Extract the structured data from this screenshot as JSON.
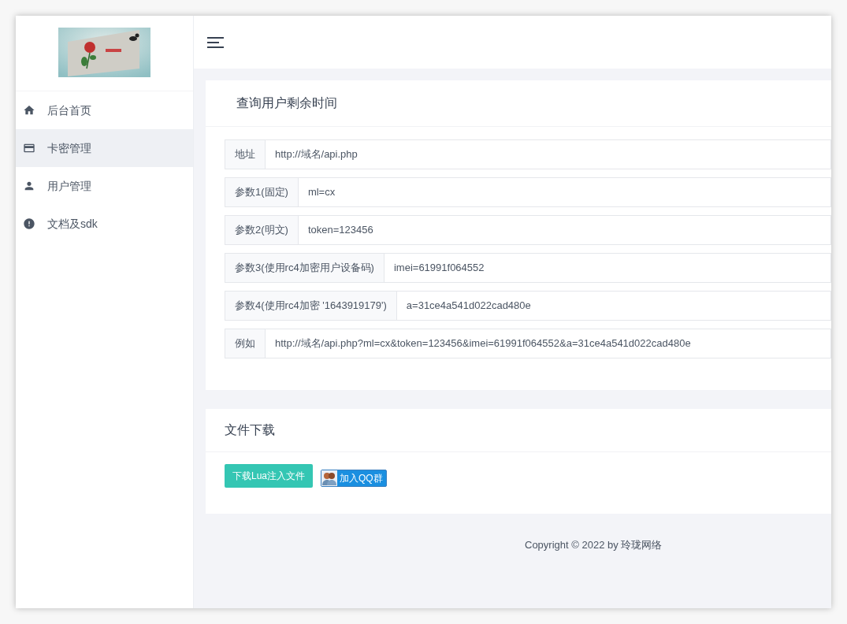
{
  "sidebar": {
    "items": [
      {
        "label": "后台首页",
        "kind": "home",
        "selected": false
      },
      {
        "label": "卡密管理",
        "kind": "card",
        "selected": true
      },
      {
        "label": "用户管理",
        "kind": "user",
        "selected": false
      },
      {
        "label": "文档及sdk",
        "kind": "alert",
        "selected": false
      }
    ]
  },
  "query_card": {
    "title": "查询用户剩余时间",
    "rows": [
      {
        "label": "地址",
        "value": "http://域名/api.php"
      },
      {
        "label": "参数1(固定)",
        "value": "ml=cx"
      },
      {
        "label": "参数2(明文)",
        "value": "token=123456"
      },
      {
        "label": "参数3(使用rc4加密用户设备码)",
        "value": "imei=61991f064552"
      },
      {
        "label": "参数4(使用rc4加密 '1643919179')",
        "value": "a=31ce4a541d022cad480e"
      },
      {
        "label": "例如",
        "value": "http://域名/api.php?ml=cx&token=123456&imei=61991f064552&a=31ce4a541d022cad480e"
      }
    ]
  },
  "download_card": {
    "title": "文件下载",
    "download_button": "下载Lua注入文件",
    "qq_button": "加入QQ群"
  },
  "footer": "Copyright © 2022 by 玲珑网络"
}
